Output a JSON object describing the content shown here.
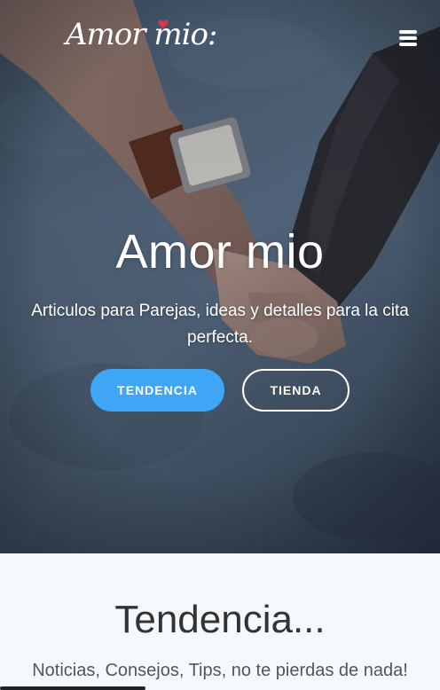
{
  "header": {
    "logo_text": "Amor mio:",
    "menu_icon": "hamburger-menu-icon"
  },
  "hero": {
    "title": "Amor mio",
    "subtitle": "Articulos para Parejas, ideas y detalles para la cita perfecta.",
    "primary_button": "TENDENCIA",
    "secondary_button": "TIENDA",
    "image": "couple-holding-hands-photo"
  },
  "trending": {
    "title": "Tendencia...",
    "subtitle": "Noticias, Consejos, Tips, no te pierdas de nada!"
  },
  "colors": {
    "accent": "#3ea6f5",
    "hero_overlay": "#2d3a4c",
    "section_bg": "#f5f9fc",
    "heart": "#e0344b"
  }
}
